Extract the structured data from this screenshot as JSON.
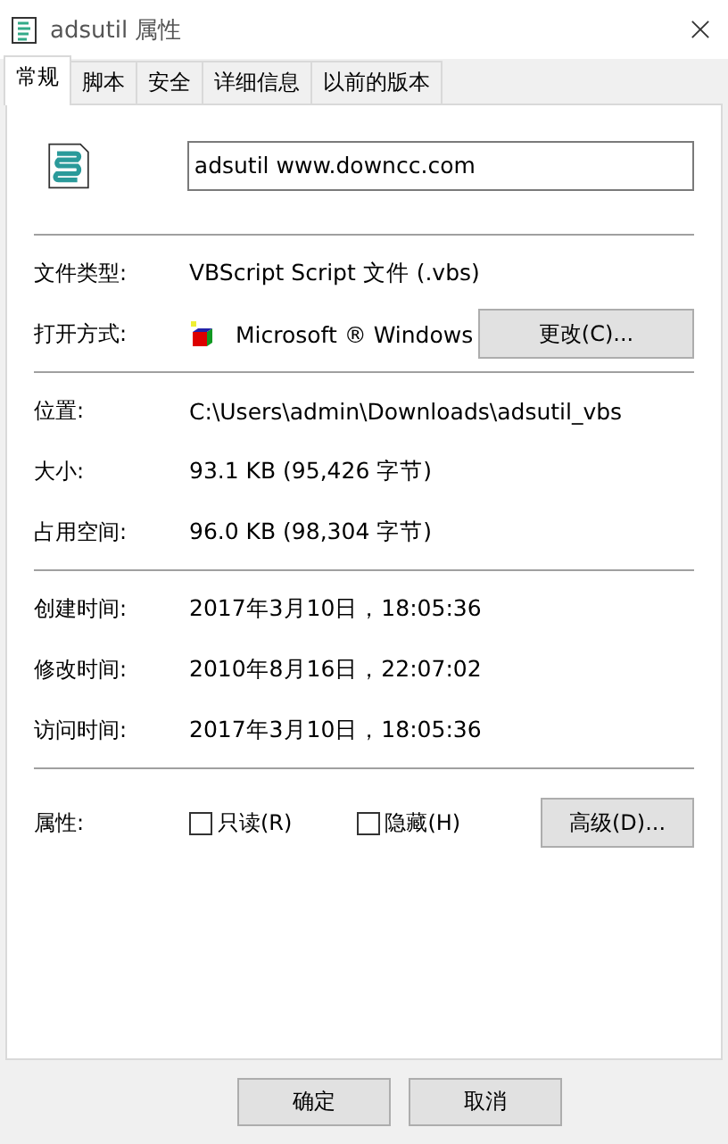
{
  "window": {
    "title": "adsutil 属性"
  },
  "tabs": [
    {
      "label": "常规",
      "selected": true
    },
    {
      "label": "脚本",
      "selected": false
    },
    {
      "label": "安全",
      "selected": false
    },
    {
      "label": "详细信息",
      "selected": false
    },
    {
      "label": "以前的版本",
      "selected": false
    }
  ],
  "file_name": {
    "value": "adsutil    www.downcc.com"
  },
  "type_row": {
    "label": "文件类型:",
    "value": "VBScript Script 文件 (.vbs)"
  },
  "open_with": {
    "label": "打开方式:",
    "value": "Microsoft ® Windows",
    "button": "更改(C)..."
  },
  "location_rows": [
    {
      "label": "位置:",
      "value": "C:\\Users\\admin\\Downloads\\adsutil_vbs"
    },
    {
      "label": "大小:",
      "value": "93.1 KB (95,426 字节)"
    },
    {
      "label": "占用空间:",
      "value": "96.0 KB (98,304 字节)"
    }
  ],
  "time_rows": [
    {
      "label": "创建时间:",
      "value": "2017年3月10日，18:05:36"
    },
    {
      "label": "修改时间:",
      "value": "2010年8月16日，22:07:02"
    },
    {
      "label": "访问时间:",
      "value": "2017年3月10日，18:05:36"
    }
  ],
  "attributes": {
    "label": "属性:",
    "checkboxes": [
      {
        "label": "只读(R)",
        "checked": false
      },
      {
        "label": "隐藏(H)",
        "checked": false
      }
    ],
    "button": "高级(D)..."
  },
  "buttons": [
    "确定",
    "取消"
  ]
}
